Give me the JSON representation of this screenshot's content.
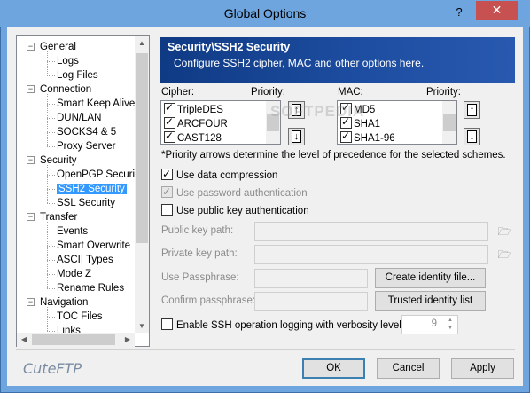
{
  "window": {
    "title": "Global Options",
    "help": "?",
    "close": "✕"
  },
  "tree": {
    "items": [
      {
        "label": "General",
        "expander": "−"
      },
      {
        "label": "Logs"
      },
      {
        "label": "Log Files"
      },
      {
        "label": "Connection",
        "expander": "−"
      },
      {
        "label": "Smart Keep Alive"
      },
      {
        "label": "DUN/LAN"
      },
      {
        "label": "SOCKS4 & 5"
      },
      {
        "label": "Proxy Server"
      },
      {
        "label": "Security",
        "expander": "−"
      },
      {
        "label": "OpenPGP Security"
      },
      {
        "label": "SSH2 Security",
        "selected": true
      },
      {
        "label": "SSL Security"
      },
      {
        "label": "Transfer",
        "expander": "−"
      },
      {
        "label": "Events"
      },
      {
        "label": "Smart Overwrite"
      },
      {
        "label": "ASCII Types"
      },
      {
        "label": "Mode Z"
      },
      {
        "label": "Rename Rules"
      },
      {
        "label": "Navigation",
        "expander": "−"
      },
      {
        "label": "TOC Files"
      },
      {
        "label": "Links"
      }
    ]
  },
  "banner": {
    "title": "Security\\SSH2 Security",
    "subtitle": "Configure SSH2 cipher, MAC and other options here."
  },
  "cipher": {
    "label": "Cipher:",
    "priority_label": "Priority:",
    "items": [
      {
        "label": "TripleDES",
        "checked": true
      },
      {
        "label": "ARCFOUR",
        "checked": true
      },
      {
        "label": "CAST128",
        "checked": true
      }
    ],
    "up_icon": "↑",
    "down_icon": "↓"
  },
  "mac": {
    "label": "MAC:",
    "priority_label": "Priority:",
    "items": [
      {
        "label": "MD5",
        "checked": true
      },
      {
        "label": "SHA1",
        "checked": true
      },
      {
        "label": "SHA1-96",
        "checked": true
      }
    ],
    "up_icon": "↑",
    "down_icon": "↓"
  },
  "priority_note": "*Priority arrows determine the level of precedence for the selected schemes.",
  "options": {
    "use_data_compression": {
      "label": "Use data compression",
      "checked": true
    },
    "use_password_auth": {
      "label": "Use password authentication",
      "checked": true,
      "disabled": true
    },
    "use_public_key_auth": {
      "label": "Use public key authentication",
      "checked": false
    }
  },
  "fields": {
    "public_key_path": {
      "label": "Public key path:",
      "value": ""
    },
    "private_key_path": {
      "label": "Private key path:",
      "value": ""
    },
    "use_passphrase": {
      "label": "Use Passphrase:",
      "value": ""
    },
    "confirm_passphrase": {
      "label": "Confirm passphrase:",
      "value": ""
    }
  },
  "buttons": {
    "create_identity": "Create identity file...",
    "trusted_identity": "Trusted identity list",
    "ok": "OK",
    "cancel": "Cancel",
    "apply": "Apply"
  },
  "logging": {
    "label": "Enable SSH operation logging with verbosity level:",
    "checked": false,
    "verbosity": "9"
  },
  "logo": "CuteFTP",
  "watermark": "SOFTPEDIA"
}
